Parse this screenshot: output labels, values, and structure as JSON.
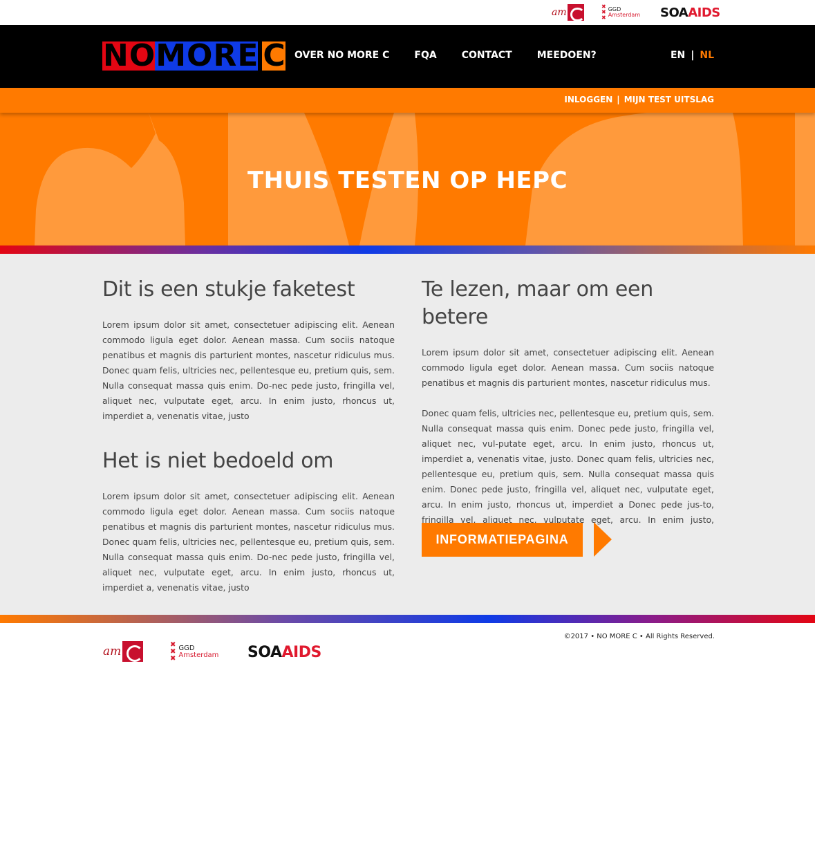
{
  "partners": {
    "amc": "am",
    "ggd_line1": "GGD",
    "ggd_line2": "Amsterdam",
    "soa": "SOA",
    "aids": "AIDS"
  },
  "brand": {
    "letters": [
      "N",
      "O",
      "M",
      "O",
      "R",
      "E",
      "C"
    ],
    "colors": {
      "red": "#e30613",
      "blue": "#0f3be6",
      "orange": "#ff7a00",
      "black": "#000000"
    }
  },
  "nav": {
    "items": [
      {
        "label": "OVER NO MORE C"
      },
      {
        "label": "FQA"
      },
      {
        "label": "CONTACT"
      },
      {
        "label": "MEEDOEN?"
      }
    ],
    "lang_en": "EN",
    "lang_sep": "|",
    "lang_nl": "NL"
  },
  "subnav": {
    "login": "INLOGGEN",
    "sep": "|",
    "results": "MIJN TEST UITSLAG"
  },
  "hero": {
    "title": "THUIS TESTEN OP HEPC"
  },
  "left": {
    "heading1": "Dit is een stukje faketest",
    "para1": "Lorem ipsum dolor sit amet, consectetuer adipiscing elit. Aenean commodo ligula eget dolor. Aenean massa. Cum sociis natoque penatibus et magnis dis parturient montes, nascetur ridiculus mus. Donec quam felis, ultricies nec, pellentesque eu, pretium quis, sem. Nulla consequat massa quis enim. Do-nec pede justo, fringilla vel, aliquet nec, vulputate eget, arcu. In enim justo, rhoncus ut, imperdiet a, venenatis vitae, justo",
    "heading2": "Het is niet bedoeld om",
    "para2": "Lorem ipsum dolor sit amet, consectetuer adipiscing elit. Aenean commodo ligula eget dolor. Aenean massa. Cum sociis natoque penatibus et magnis dis parturient montes, nascetur ridiculus mus. Donec quam felis, ultricies nec, pellentesque eu, pretium quis, sem. Nulla consequat massa quis enim. Do-nec pede justo, fringilla vel, aliquet nec, vulputate eget, arcu. In enim justo, rhoncus ut, imperdiet a, venenatis vitae, justo"
  },
  "right": {
    "heading1": "Te lezen, maar om een betere",
    "para1": "Lorem ipsum dolor sit amet, consectetuer adipiscing elit. Aenean commodo ligula eget dolor. Aenean massa. Cum sociis natoque penatibus et magnis dis parturient montes, nascetur ridiculus mus.",
    "para2": "Donec quam felis, ultricies nec, pellentesque eu, pretium quis, sem. Nulla consequat massa quis enim. Donec pede justo, fringilla vel, aliquet nec, vul-putate eget, arcu. In enim justo, rhoncus ut, imperdiet a, venenatis vitae, justo. Donec quam felis, ultricies nec, pellentesque eu, pretium quis, sem. Nulla consequat massa quis enim. Donec pede justo, fringilla vel, aliquet nec, vulputate eget, arcu. In enim justo, rhoncus ut, imperdiet a Donec pede jus-to, fringilla vel, aliquet nec, vulputate eget, arcu. In enim justo, rhoncus ut, imperdiet a",
    "button": "INFORMATIEPAGINA"
  },
  "footer": {
    "copyright": "©2017 • NO MORE C  • All Rights Reserved."
  },
  "icons": {
    "arrow": "arrow-right-icon"
  }
}
